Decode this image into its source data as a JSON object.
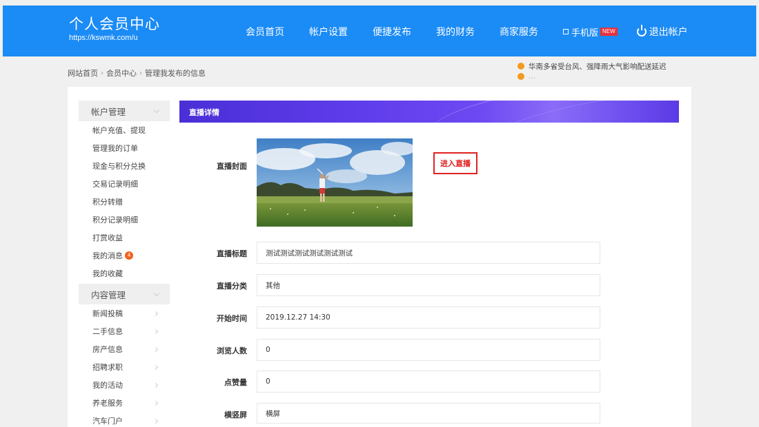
{
  "header": {
    "title": "个人会员中心",
    "url": "https://kswmk.com/u",
    "nav": [
      "会员首页",
      "帐户设置",
      "便捷发布",
      "我的财务",
      "商家服务"
    ],
    "mobile_label": "手机版",
    "new_badge": "NEW",
    "logout_label": "退出帐户",
    "bg_color": "#1b8bf5"
  },
  "breadcrumb": [
    "网站首页",
    "会员中心",
    "管理我发布的信息"
  ],
  "ticker": {
    "line1": "华南多省受台风、强降雨大气影响配送延迟",
    "line2": "…"
  },
  "sidebar": {
    "groups": [
      {
        "title": "帐户管理",
        "items": [
          "帐户充值、提现",
          "管理我的订单",
          "现金与积分兑换",
          "交易记录明细",
          "积分转赠",
          "积分记录明细",
          "打赏收益",
          "我的消息",
          "我的收藏"
        ]
      },
      {
        "title": "内容管理",
        "items": [
          "新闻投稿",
          "二手信息",
          "房产信息",
          "招聘求职",
          "我的活动",
          "养老服务",
          "汽车门户"
        ]
      }
    ],
    "message_count": "4"
  },
  "detail": {
    "title": "直播详情",
    "cover_label": "直播封面",
    "enter_live_label": "进入直播",
    "fields": [
      {
        "label": "直播标题",
        "value": "测试测试测试测试测试测试"
      },
      {
        "label": "直播分类",
        "value": "其他"
      },
      {
        "label": "开始时间",
        "value": "2019.12.27 14:30"
      },
      {
        "label": "浏览人数",
        "value": "0"
      },
      {
        "label": "点赞量",
        "value": "0"
      },
      {
        "label": "横竖屏",
        "value": "横屏"
      }
    ]
  },
  "colors": {
    "accent": "#1b8bf5",
    "header_bar": "#5f3cea",
    "live_button": "#e02020"
  }
}
